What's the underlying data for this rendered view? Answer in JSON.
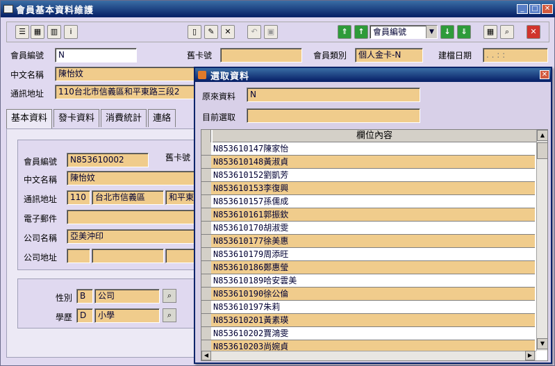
{
  "window": {
    "title": "會員基本資料維護"
  },
  "toolbar": {
    "search_field_value": "會員編號"
  },
  "header": {
    "member_no_label": "會員編號",
    "member_no_value": "N",
    "old_card_label": "舊卡號",
    "old_card_value": "",
    "member_class_label": "會員類別",
    "member_class_value": "個人金卡-N",
    "created_label": "建檔日期",
    "created_value": ". .  : :",
    "chinese_name_label": "中文名稱",
    "chinese_name_value": "陳怡妏",
    "address_label": "通訊地址",
    "address_value": "110台北市信義區和平東路三段2"
  },
  "tabs": [
    "基本資料",
    "發卡資料",
    "消費統計",
    "連絡"
  ],
  "basic": {
    "member_no_label": "會員編號",
    "member_no_value": "N853610002",
    "old_card_label": "舊卡號",
    "chinese_name_label": "中文名稱",
    "chinese_name_value": "陳怡妏",
    "address_label": "通訊地址",
    "zip_value": "110",
    "city_value": "台北市信義區",
    "street_value": "和平東",
    "email_label": "電子郵件",
    "email_value": "",
    "company_label": "公司名稱",
    "company_value": "亞美沖印",
    "company_addr_label": "公司地址"
  },
  "profile": {
    "gender_label": "性別",
    "gender_code": "B",
    "gender_value": "公司",
    "education_label": "學歷",
    "education_code": "D",
    "education_value": "小學"
  },
  "dialog": {
    "title": "選取資料",
    "original_label": "原來資料",
    "original_value": "N",
    "current_label": "目前選取",
    "current_value": "",
    "column_header": "欄位內容",
    "rows": [
      "N853610147陳家怡",
      "N853610148黃淑貞",
      "N853610152劉凱芳",
      "N853610153李復興",
      "N853610157孫儒成",
      "N853610161郭振欽",
      "N853610170胡淑雯",
      "N853610177徐美惠",
      "N853610179周添旺",
      "N853610186鄭惠瑩",
      "N853610189哈安雲美",
      "N853610190徐公倫",
      "N853610197朱莉",
      "N853610201黃素瑛",
      "N853610202賈鴻雯",
      "N853610203尚婉貞"
    ]
  },
  "colors": {
    "field_bg": "#f0cc8c",
    "titlebar": "#0a246a",
    "panel_bg": "#e0d9f0"
  }
}
